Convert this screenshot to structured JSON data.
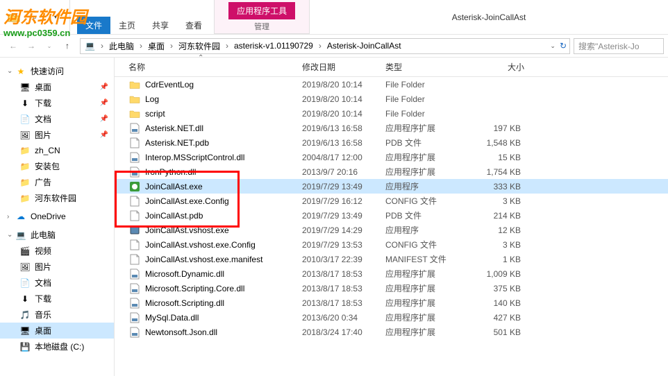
{
  "window_title": "Asterisk-JoinCallAst",
  "ribbon": {
    "file": "文件",
    "home": "主页",
    "share": "共享",
    "view": "查看",
    "tools": "应用程序工具",
    "manage": "管理"
  },
  "breadcrumb": [
    "此电脑",
    "桌面",
    "河东软件园",
    "asterisk-v1.01190729",
    "Asterisk-JoinCallAst"
  ],
  "search_placeholder": "搜索\"Asterisk-Jo",
  "columns": {
    "name": "名称",
    "date": "修改日期",
    "type": "类型",
    "size": "大小"
  },
  "sidebar": {
    "quick": {
      "label": "快速访问",
      "items": [
        {
          "label": "桌面",
          "icon": "desktop",
          "pinned": true
        },
        {
          "label": "下载",
          "icon": "download",
          "pinned": true
        },
        {
          "label": "文档",
          "icon": "doc",
          "pinned": true
        },
        {
          "label": "图片",
          "icon": "pic",
          "pinned": true
        },
        {
          "label": "zh_CN",
          "icon": "folder"
        },
        {
          "label": "安装包",
          "icon": "folder"
        },
        {
          "label": "广告",
          "icon": "folder"
        },
        {
          "label": "河东软件园",
          "icon": "folder"
        }
      ]
    },
    "onedrive": "OneDrive",
    "thispc": {
      "label": "此电脑",
      "items": [
        {
          "label": "视频",
          "icon": "video"
        },
        {
          "label": "图片",
          "icon": "pic"
        },
        {
          "label": "文档",
          "icon": "doc"
        },
        {
          "label": "下载",
          "icon": "download"
        },
        {
          "label": "音乐",
          "icon": "music"
        },
        {
          "label": "桌面",
          "icon": "desktop",
          "selected": true
        },
        {
          "label": "本地磁盘 (C:)",
          "icon": "disk"
        }
      ]
    }
  },
  "files": [
    {
      "name": "CdrEventLog",
      "date": "2019/8/20 10:14",
      "type": "File Folder",
      "size": "",
      "icon": "folder"
    },
    {
      "name": "Log",
      "date": "2019/8/20 10:14",
      "type": "File Folder",
      "size": "",
      "icon": "folder"
    },
    {
      "name": "script",
      "date": "2019/8/20 10:14",
      "type": "File Folder",
      "size": "",
      "icon": "folder"
    },
    {
      "name": "Asterisk.NET.dll",
      "date": "2019/6/13 16:58",
      "type": "应用程序扩展",
      "size": "197 KB",
      "icon": "dll"
    },
    {
      "name": "Asterisk.NET.pdb",
      "date": "2019/6/13 16:58",
      "type": "PDB 文件",
      "size": "1,548 KB",
      "icon": "file"
    },
    {
      "name": "Interop.MSScriptControl.dll",
      "date": "2004/8/17 12:00",
      "type": "应用程序扩展",
      "size": "15 KB",
      "icon": "dll"
    },
    {
      "name": "IronPython.dll",
      "date": "2013/9/7 20:16",
      "type": "应用程序扩展",
      "size": "1,754 KB",
      "icon": "dll"
    },
    {
      "name": "JoinCallAst.exe",
      "date": "2019/7/29 13:49",
      "type": "应用程序",
      "size": "333 KB",
      "icon": "exe",
      "selected": true
    },
    {
      "name": "JoinCallAst.exe.Config",
      "date": "2019/7/29 16:12",
      "type": "CONFIG 文件",
      "size": "3 KB",
      "icon": "file"
    },
    {
      "name": "JoinCallAst.pdb",
      "date": "2019/7/29 13:49",
      "type": "PDB 文件",
      "size": "214 KB",
      "icon": "file"
    },
    {
      "name": "JoinCallAst.vshost.exe",
      "date": "2019/7/29 14:29",
      "type": "应用程序",
      "size": "12 KB",
      "icon": "exe2"
    },
    {
      "name": "JoinCallAst.vshost.exe.Config",
      "date": "2019/7/29 13:53",
      "type": "CONFIG 文件",
      "size": "3 KB",
      "icon": "file"
    },
    {
      "name": "JoinCallAst.vshost.exe.manifest",
      "date": "2010/3/17 22:39",
      "type": "MANIFEST 文件",
      "size": "1 KB",
      "icon": "file"
    },
    {
      "name": "Microsoft.Dynamic.dll",
      "date": "2013/8/17 18:53",
      "type": "应用程序扩展",
      "size": "1,009 KB",
      "icon": "dll"
    },
    {
      "name": "Microsoft.Scripting.Core.dll",
      "date": "2013/8/17 18:53",
      "type": "应用程序扩展",
      "size": "375 KB",
      "icon": "dll"
    },
    {
      "name": "Microsoft.Scripting.dll",
      "date": "2013/8/17 18:53",
      "type": "应用程序扩展",
      "size": "140 KB",
      "icon": "dll"
    },
    {
      "name": "MySql.Data.dll",
      "date": "2013/6/20 0:34",
      "type": "应用程序扩展",
      "size": "427 KB",
      "icon": "dll"
    },
    {
      "name": "Newtonsoft.Json.dll",
      "date": "2018/3/24 17:40",
      "type": "应用程序扩展",
      "size": "501 KB",
      "icon": "dll"
    }
  ],
  "watermark": {
    "text": "河东软件园",
    "url": "www.pc0359.cn"
  }
}
